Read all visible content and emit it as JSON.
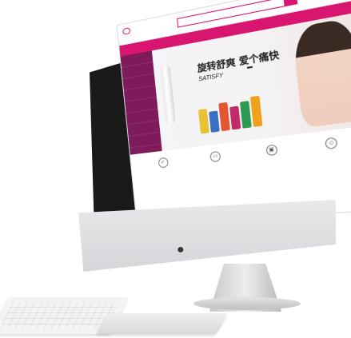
{
  "site": {
    "logo_text": "",
    "search_button": "",
    "cart_text": "",
    "nav_items": [
      "",
      "",
      "",
      "",
      "",
      "",
      "",
      "",
      ""
    ],
    "sidebar_items": [
      "",
      "",
      "",
      "",
      "",
      "",
      "",
      ""
    ]
  },
  "banner": {
    "headline": "旋转舒爽 爱个痛快",
    "subline": "SATISFY",
    "tag": ""
  },
  "features": [
    {
      "icon": "shield-icon",
      "text": ""
    },
    {
      "icon": "truck-icon",
      "text": ""
    },
    {
      "icon": "lock-icon",
      "text": ""
    },
    {
      "icon": "gift-icon",
      "text": ""
    }
  ],
  "hardware": {
    "apple_logo": ""
  },
  "colors": {
    "accent": "#d9166f",
    "sidebar": "#7e1b5b"
  }
}
